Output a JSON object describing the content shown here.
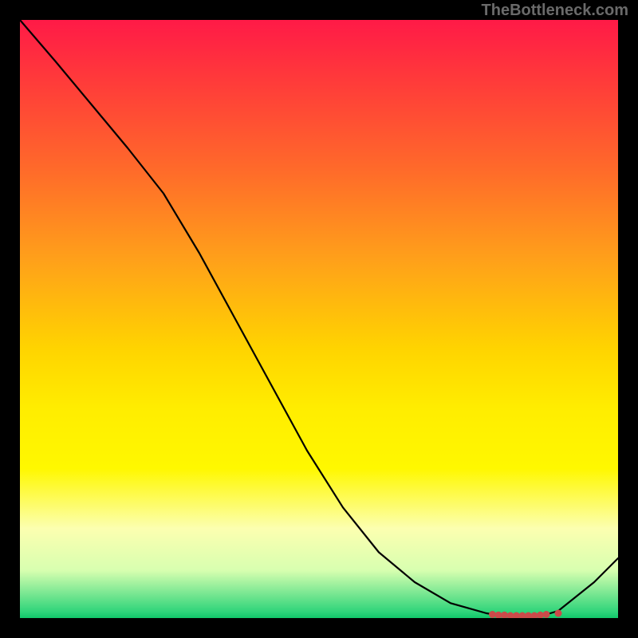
{
  "attribution": "TheBottleneck.com",
  "chart_data": {
    "type": "line",
    "title": "",
    "xlabel": "",
    "ylabel": "",
    "ylim": [
      0,
      100
    ],
    "x": [
      0.0,
      0.06,
      0.12,
      0.18,
      0.24,
      0.3,
      0.36,
      0.42,
      0.48,
      0.54,
      0.6,
      0.66,
      0.72,
      0.78,
      0.8,
      0.82,
      0.84,
      0.86,
      0.88,
      0.9,
      0.92,
      0.96,
      1.0
    ],
    "values": [
      100,
      93.0,
      85.8,
      78.6,
      71.0,
      61.0,
      50.0,
      39.0,
      28.0,
      18.5,
      11.0,
      6.0,
      2.5,
      0.8,
      0.5,
      0.4,
      0.4,
      0.4,
      0.6,
      1.2,
      2.8,
      6.0,
      10.0
    ],
    "markers_x": [
      0.79,
      0.8,
      0.81,
      0.82,
      0.83,
      0.84,
      0.85,
      0.86,
      0.87,
      0.88,
      0.9
    ],
    "markers_y": [
      0.6,
      0.5,
      0.5,
      0.4,
      0.4,
      0.4,
      0.4,
      0.4,
      0.5,
      0.6,
      0.8
    ],
    "background_gradient": [
      "#ff1a47",
      "#ffed00",
      "#11c76a"
    ]
  }
}
